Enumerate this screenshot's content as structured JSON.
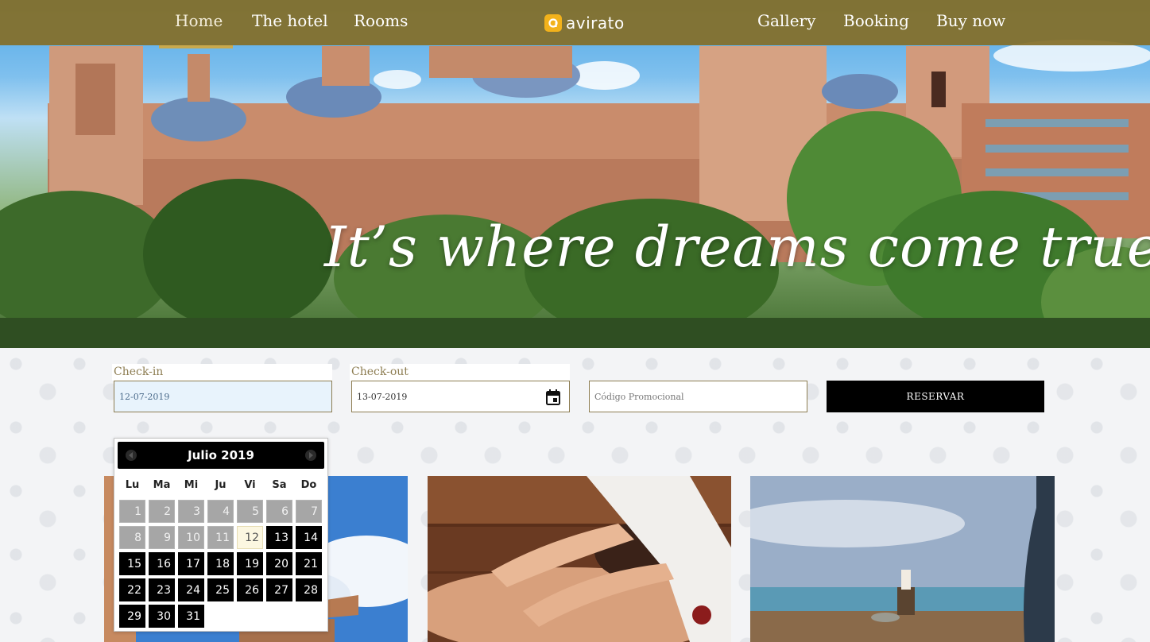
{
  "nav": {
    "left_items": [
      "Home",
      "The hotel",
      "Rooms"
    ],
    "right_items": [
      "Gallery",
      "Booking",
      "Buy now"
    ],
    "active": "Home",
    "logo_text": "avirato",
    "logo_icon": "avirato-logo-icon"
  },
  "hero": {
    "tagline": "It’s where dreams come true"
  },
  "booking": {
    "checkin_label": "Check-in",
    "checkin_value": "12-07-2019",
    "checkout_label": "Check-out",
    "checkout_value": "13-07-2019",
    "promo_placeholder": "Código Promocional",
    "reserve_label": "RESERVAR",
    "calendar_icon": "calendar-icon"
  },
  "datepicker": {
    "title": "Julio 2019",
    "weekdays": [
      "Lu",
      "Ma",
      "Mi",
      "Ju",
      "Vi",
      "Sa",
      "Do"
    ],
    "weeks": [
      [
        "1",
        "2",
        "3",
        "4",
        "5",
        "6",
        "7"
      ],
      [
        "8",
        "9",
        "10",
        "11",
        "12",
        "13",
        "14"
      ],
      [
        "15",
        "16",
        "17",
        "18",
        "19",
        "20",
        "21"
      ],
      [
        "22",
        "23",
        "24",
        "25",
        "26",
        "27",
        "28"
      ],
      [
        "29",
        "30",
        "31",
        "",
        "",
        "",
        ""
      ]
    ],
    "today": "12",
    "first_available": 13
  },
  "colors": {
    "nav_bg": "#846e26",
    "accent": "#8d7d52",
    "button": "#000000"
  }
}
